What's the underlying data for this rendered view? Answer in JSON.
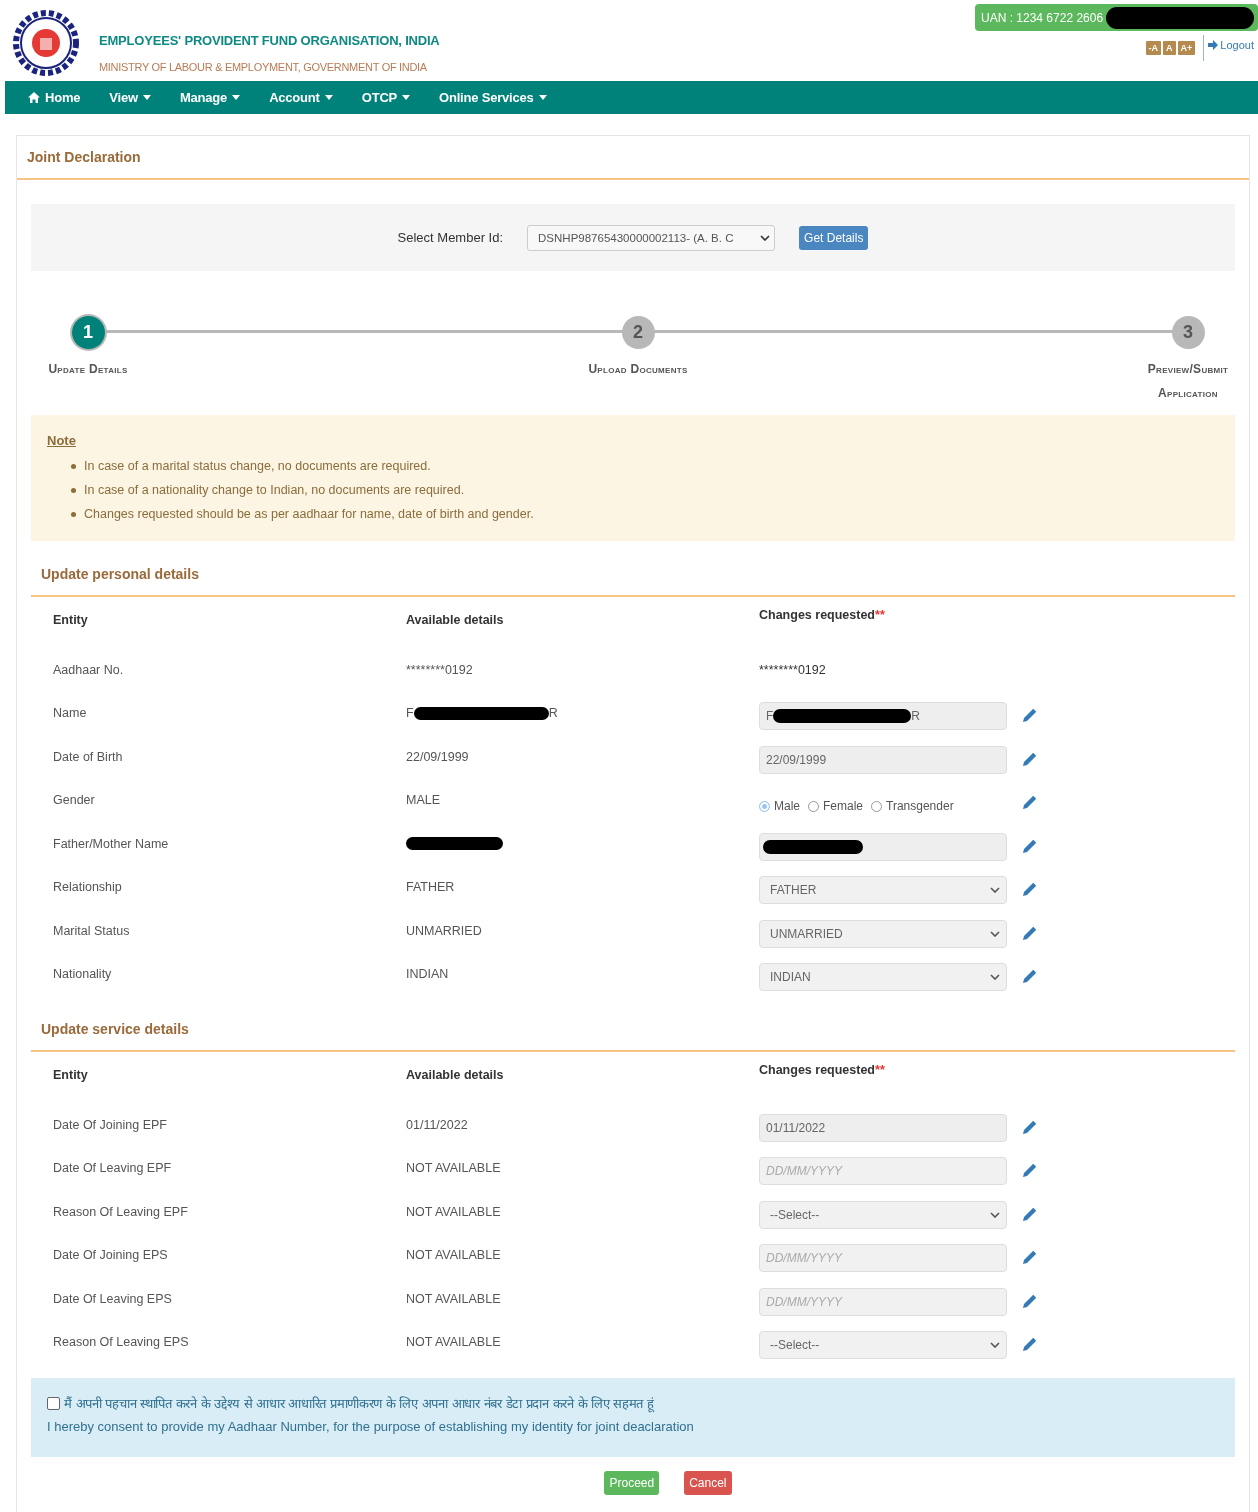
{
  "header": {
    "title": "EMPLOYEES' PROVIDENT FUND ORGANISATION, INDIA",
    "subtitle": "MINISTRY OF LABOUR & EMPLOYMENT, GOVERNMENT OF INDIA",
    "uan": "UAN : 1234 6722 2606",
    "font_buttons": [
      "-A",
      "A",
      "A+"
    ],
    "logout": "Logout"
  },
  "nav": [
    {
      "label": "Home",
      "kind": "home",
      "dropdown": false
    },
    {
      "label": "View",
      "dropdown": true
    },
    {
      "label": "Manage",
      "dropdown": true
    },
    {
      "label": "Account",
      "dropdown": true
    },
    {
      "label": "OTCP",
      "dropdown": true
    },
    {
      "label": "Online Services",
      "dropdown": true
    }
  ],
  "panel_title": "Joint Declaration",
  "member": {
    "label": "Select Member Id:",
    "value": "DSNHP98765430000002113- (A. B. C",
    "button": "Get Details"
  },
  "steps": [
    {
      "number": "1",
      "label": "Update Details",
      "selected": true
    },
    {
      "number": "2",
      "label": "Upload Documents",
      "selected": false
    },
    {
      "number": "3",
      "label": "Preview/Submit Application",
      "selected": false
    }
  ],
  "note": {
    "title": "Note",
    "items": [
      "In case of a marital status change, no documents are required.",
      "In case of a nationality change to Indian, no documents are required.",
      "Changes requested should be as per aadhaar for name, date of birth and gender."
    ]
  },
  "sections": [
    {
      "title": "Update personal details",
      "columns": [
        "Entity",
        "Available details",
        "Changes requested"
      ],
      "required_mark": "**",
      "rows": [
        {
          "entity": "Aadhaar No.",
          "available": {
            "kind": "text",
            "text": "********0192"
          },
          "change": {
            "kind": "text",
            "text": "********0192"
          },
          "edit_icon": false
        },
        {
          "entity": "Name",
          "available": {
            "kind": "redacted",
            "prefix": "F",
            "suffix": "R"
          },
          "change": {
            "kind": "input_redacted",
            "prefix": "F",
            "suffix": "R"
          },
          "edit_icon": true
        },
        {
          "entity": "Date of Birth",
          "available": {
            "kind": "text",
            "text": "22/09/1999"
          },
          "change": {
            "kind": "input",
            "value": "22/09/1999"
          },
          "edit_icon": true
        },
        {
          "entity": "Gender",
          "available": {
            "kind": "text",
            "text": "MALE"
          },
          "change": {
            "kind": "radio",
            "options": [
              {
                "label": "Male",
                "selected": true
              },
              {
                "label": "Female",
                "selected": false
              },
              {
                "label": "Transgender",
                "selected": false
              }
            ]
          },
          "edit_icon": true
        },
        {
          "entity": "Father/Mother Name",
          "available": {
            "kind": "redacted"
          },
          "change": {
            "kind": "input_redacted"
          },
          "edit_icon": true
        },
        {
          "entity": "Relationship",
          "available": {
            "kind": "text",
            "text": "FATHER"
          },
          "change": {
            "kind": "select",
            "value": "FATHER"
          },
          "edit_icon": true
        },
        {
          "entity": "Marital Status",
          "available": {
            "kind": "text",
            "text": "UNMARRIED"
          },
          "change": {
            "kind": "select",
            "value": "UNMARRIED"
          },
          "edit_icon": true
        },
        {
          "entity": "Nationality",
          "available": {
            "kind": "text",
            "text": "INDIAN"
          },
          "change": {
            "kind": "select",
            "value": "INDIAN"
          },
          "edit_icon": true
        }
      ]
    },
    {
      "title": "Update service details",
      "columns": [
        "Entity",
        "Available details",
        "Changes requested"
      ],
      "required_mark": "**",
      "rows": [
        {
          "entity": "Date Of Joining EPF",
          "available": {
            "kind": "text",
            "text": "01/11/2022"
          },
          "change": {
            "kind": "input",
            "value": "01/11/2022"
          },
          "edit_icon": true
        },
        {
          "entity": "Date Of Leaving EPF",
          "available": {
            "kind": "text",
            "text": "NOT AVAILABLE"
          },
          "change": {
            "kind": "date",
            "placeholder": "DD/MM/YYYY"
          },
          "edit_icon": true
        },
        {
          "entity": "Reason Of Leaving EPF",
          "available": {
            "kind": "text",
            "text": "NOT AVAILABLE"
          },
          "change": {
            "kind": "select",
            "value": "--Select--"
          },
          "edit_icon": true
        },
        {
          "entity": "Date Of Joining EPS",
          "available": {
            "kind": "text",
            "text": "NOT AVAILABLE"
          },
          "change": {
            "kind": "date",
            "placeholder": "DD/MM/YYYY"
          },
          "edit_icon": true
        },
        {
          "entity": "Date Of Leaving EPS",
          "available": {
            "kind": "text",
            "text": "NOT AVAILABLE"
          },
          "change": {
            "kind": "date",
            "placeholder": "DD/MM/YYYY"
          },
          "edit_icon": true
        },
        {
          "entity": "Reason Of Leaving EPS",
          "available": {
            "kind": "text",
            "text": "NOT AVAILABLE"
          },
          "change": {
            "kind": "select",
            "value": "--Select--"
          },
          "edit_icon": true
        }
      ]
    }
  ],
  "consent": {
    "checked": false,
    "hindi": "मैं अपनी पहचान स्थापित करने के उद्देश्य से आधार आधारित प्रमाणीकरण के लिए अपना आधार नंबर डेटा प्रदान करने के लिए सहमत हूं",
    "english": "I hereby consent to provide my Aadhaar Number, for the purpose of establishing my identity for joint deaclaration"
  },
  "buttons": [
    {
      "label": "Proceed",
      "kind": "success"
    },
    {
      "label": "Cancel",
      "kind": "danger"
    }
  ]
}
